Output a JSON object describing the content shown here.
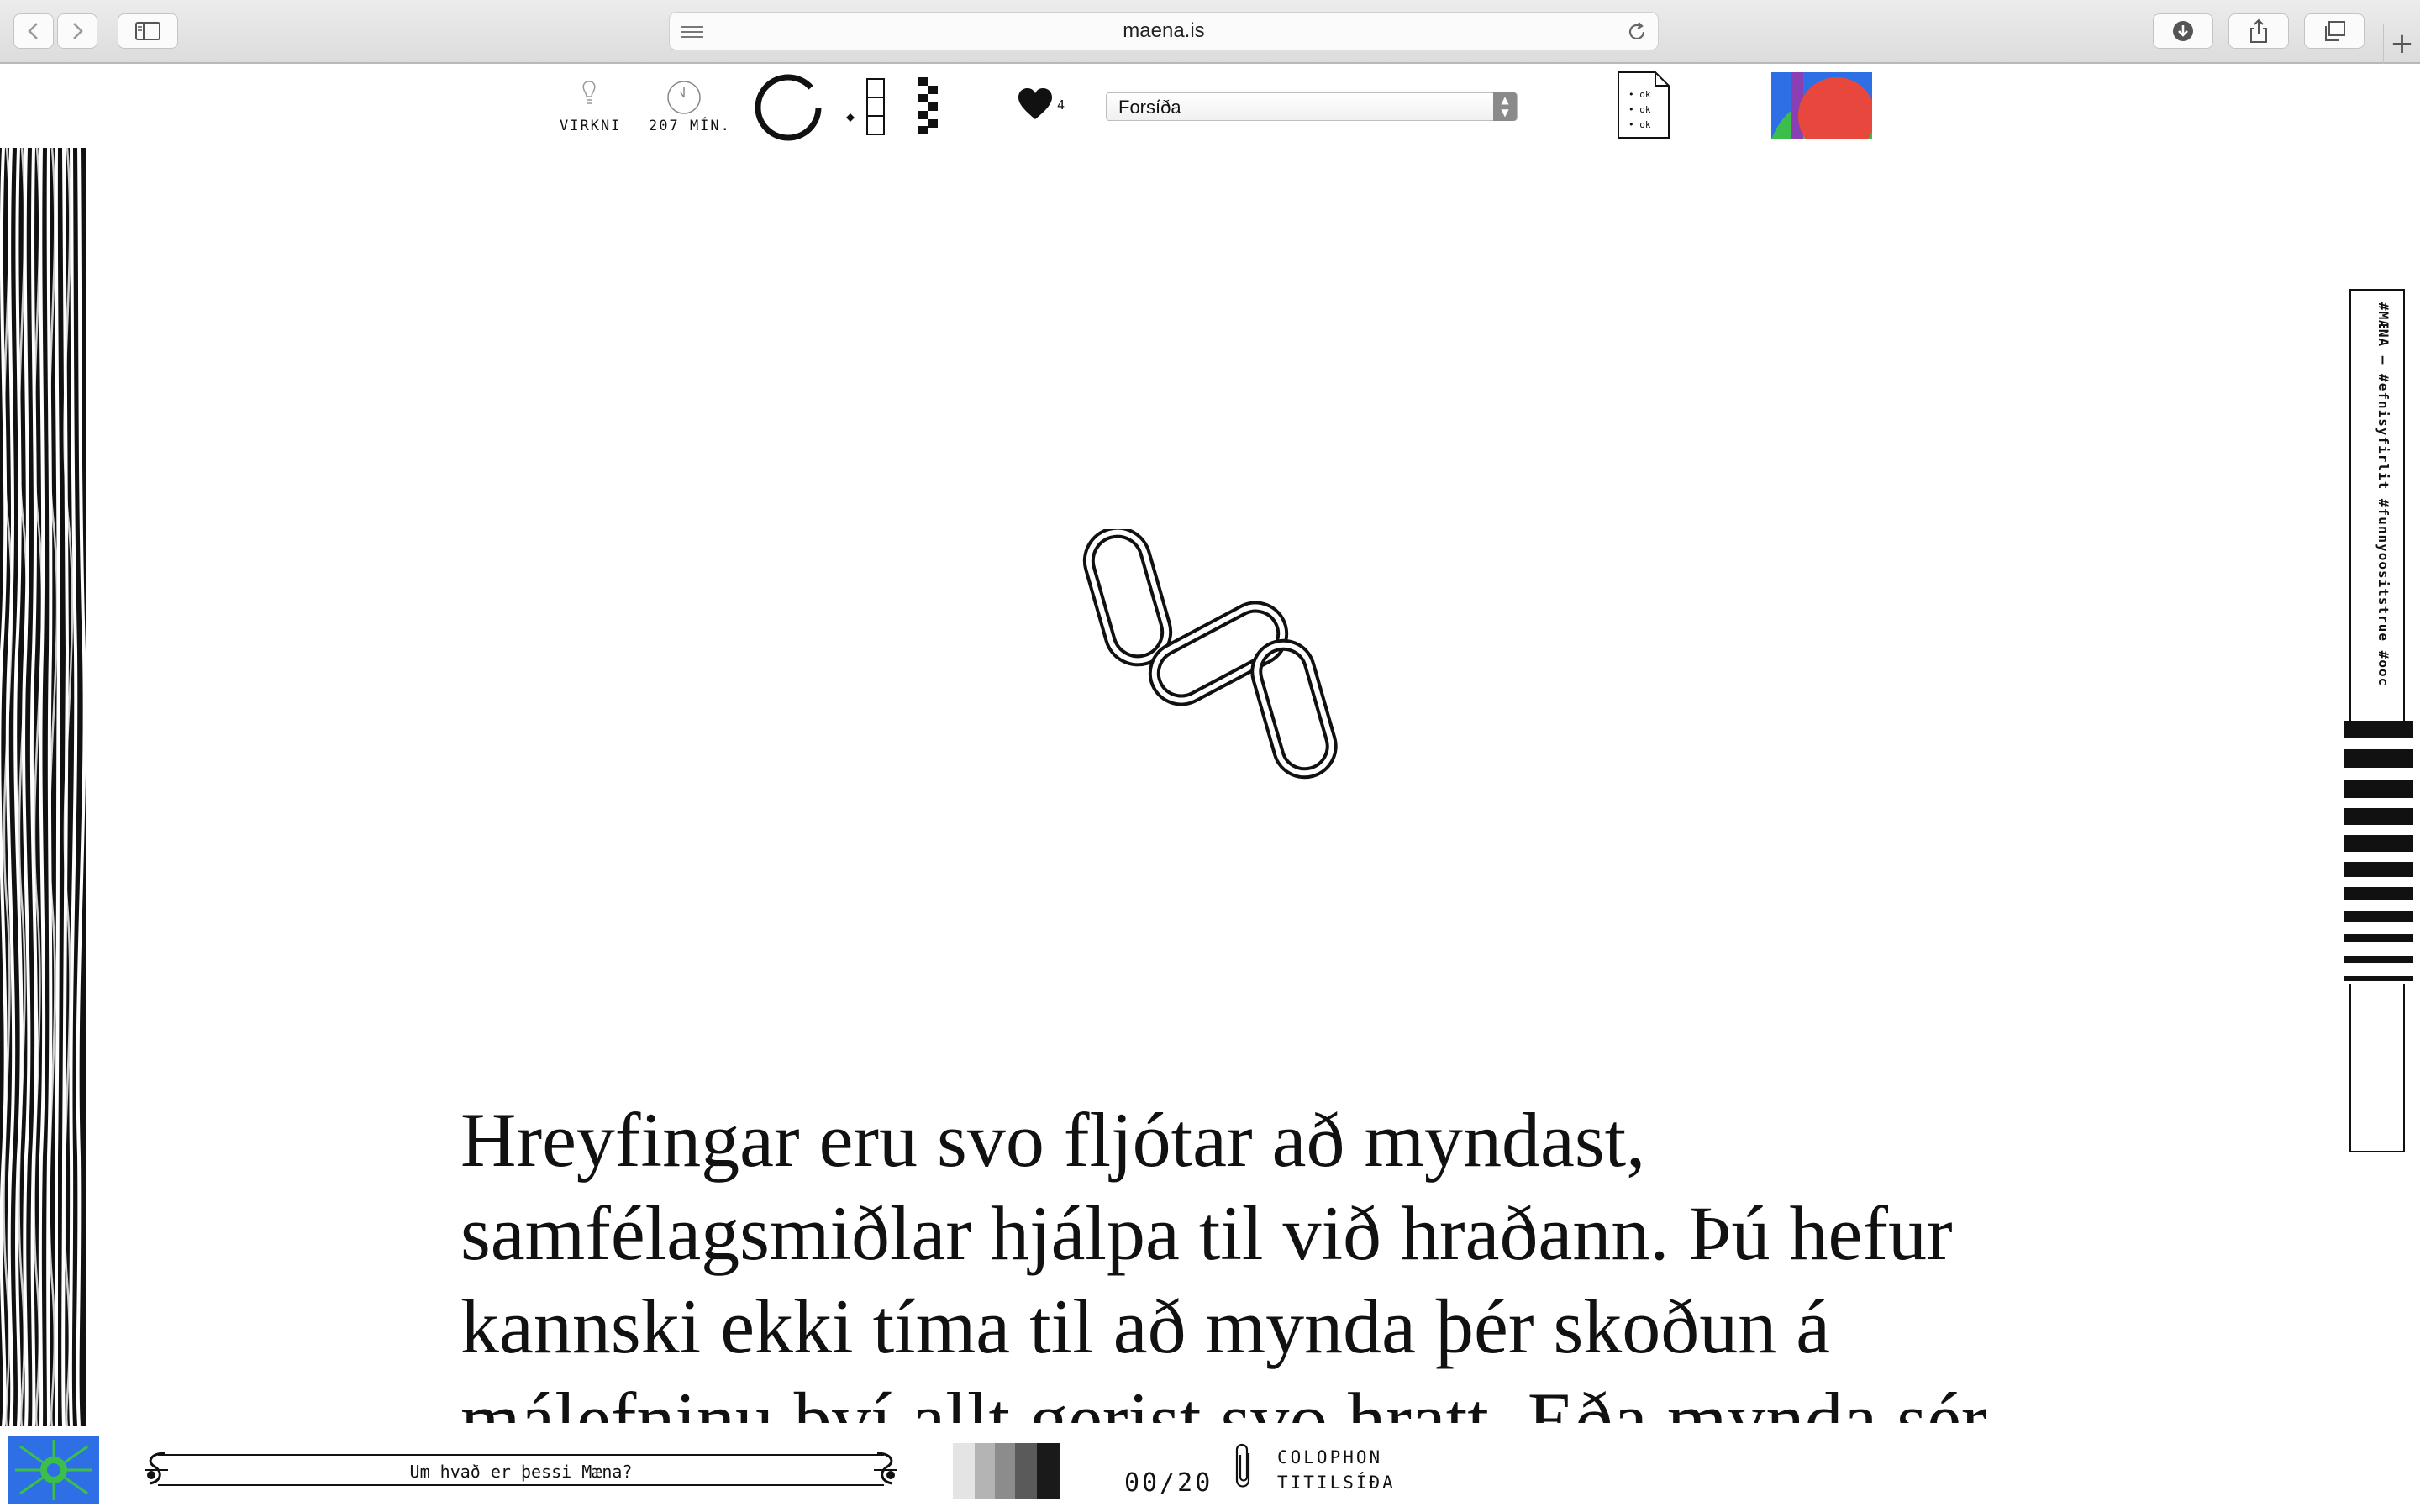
{
  "browser": {
    "url": "maena.is"
  },
  "toolbar": {
    "activity_label": "VIRKNI",
    "time_label": "207 MÍN.",
    "likes_count": "4",
    "page_select": {
      "selected": "Forsíða"
    },
    "doc_lines": [
      "• ok",
      "• ok",
      "• ok"
    ]
  },
  "main": {
    "paragraph": "Hreyfingar eru svo fljótar að myndast, samfélagsmiðlar hjálpa til við hraðann. Þú hefur kannski ekki tíma til að mynda þér skoðun á málefninu því allt gerist svo hratt. Eða mynda sér"
  },
  "sidebar": {
    "tags": "#MÆNA — #efnisyfirlit #funnyoositstrue #ooc"
  },
  "bottom": {
    "ticker_text": "Um hvað er þessi Mæna?",
    "page_counter": "00/20",
    "link_colophon": "COLOPHON",
    "link_title_page": "TITILSÍÐA"
  },
  "colors": {
    "ink": "#111111",
    "thumb_blue": "#2f6fe6",
    "thumb_red": "#e8473e",
    "thumb_green": "#3bbf4a",
    "select_arrow": "#8a8a8a"
  },
  "icons": {
    "activity": "lightbulb-icon",
    "time": "clock-icon",
    "progress": "ring-progress-icon",
    "layout": "column-grid-icon",
    "pattern": "checker-icon",
    "likes": "heart-icon",
    "doc": "document-icon",
    "hero": "chain-link-icon",
    "attachment": "paperclip-icon"
  }
}
